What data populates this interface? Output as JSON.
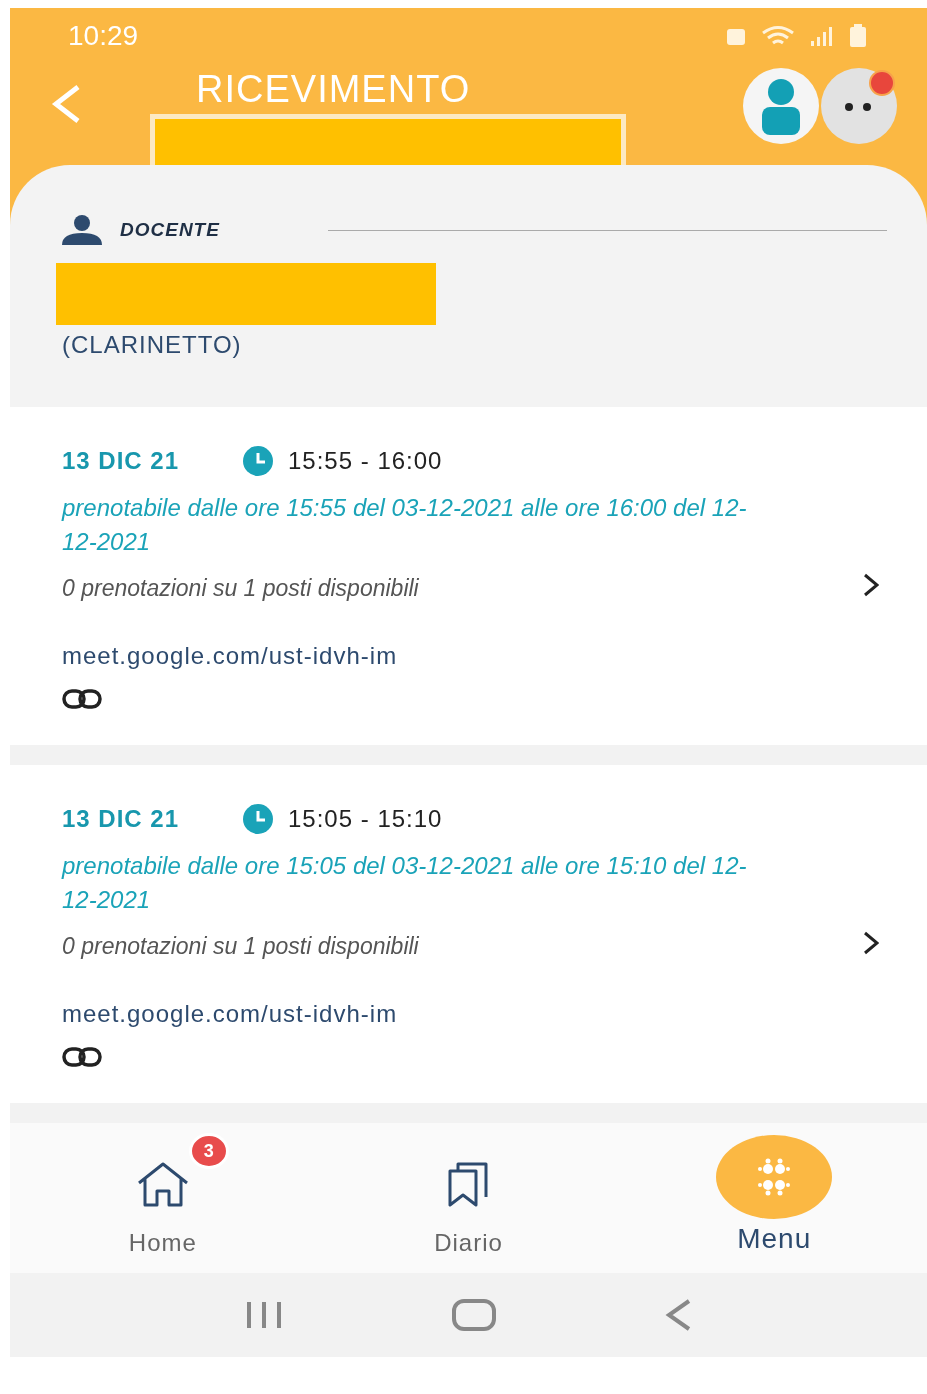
{
  "status_bar": {
    "time": "10:29"
  },
  "header": {
    "title": "RICEVIMENTO",
    "notification_dot": true
  },
  "teacher": {
    "label": "DOCENTE",
    "subject": "(CLARINETTO)"
  },
  "slots": [
    {
      "date": "13 DIC 21",
      "time": "15:55 - 16:00",
      "booking_window": "prenotabile dalle ore 15:55 del 03-12-2021 alle ore 16:00 del 12-12-2021",
      "availability": "0 prenotazioni su 1 posti disponibili",
      "link": "meet.google.com/ust-idvh-im"
    },
    {
      "date": "13 DIC 21",
      "time": "15:05 - 15:10",
      "booking_window": "prenotabile dalle ore 15:05 del 03-12-2021 alle ore 15:10 del 12-12-2021",
      "availability": "0 prenotazioni su 1 posti disponibili",
      "link": "meet.google.com/ust-idvh-im"
    }
  ],
  "nav": [
    {
      "kind": "home",
      "label": "Home",
      "badge": "3",
      "selected": false
    },
    {
      "kind": "diary",
      "label": "Diario",
      "selected": false
    },
    {
      "kind": "menu",
      "label": "Menu",
      "selected": true
    }
  ]
}
